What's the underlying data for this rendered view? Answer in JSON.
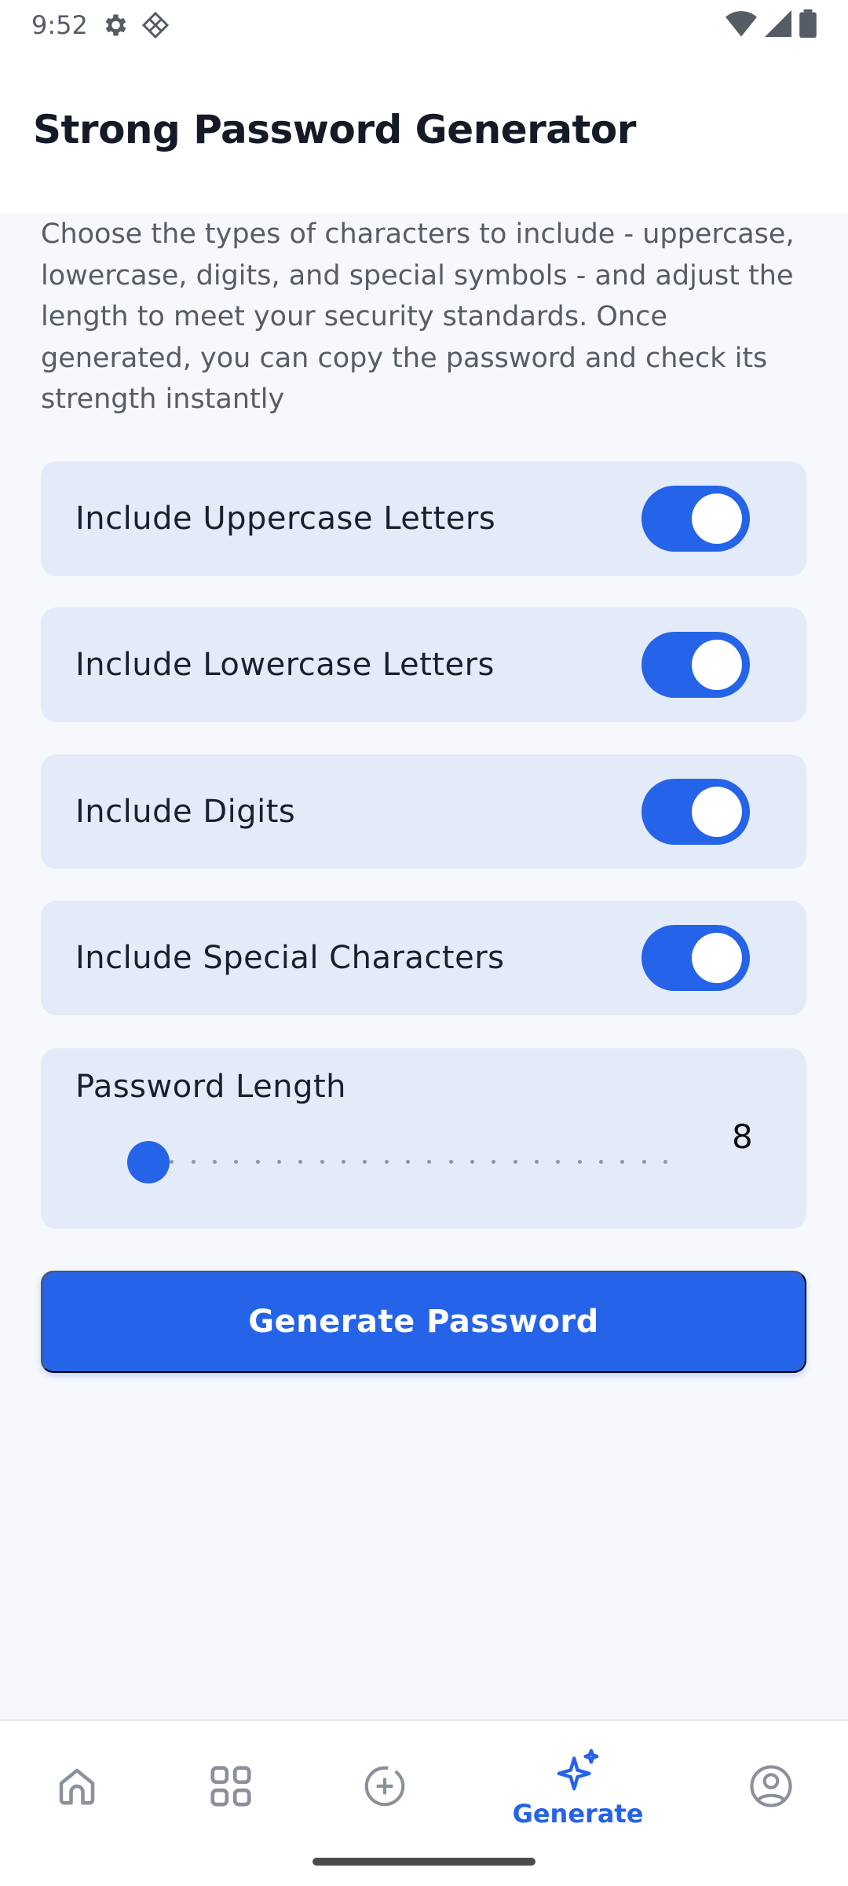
{
  "status_bar": {
    "time": "9:52",
    "left_icons": [
      "gear-icon",
      "diamond-grid-icon"
    ],
    "right_icons": [
      "wifi-icon",
      "cellular-signal-icon",
      "battery-icon"
    ]
  },
  "header": {
    "title": "Strong Password Generator"
  },
  "description": "Choose the types of characters to include - uppercase, lowercase, digits, and special symbols - and adjust the length to meet your security standards. Once generated, you can copy the password and check its strength instantly",
  "options": [
    {
      "label": "Include Uppercase Letters",
      "enabled": true
    },
    {
      "label": "Include Lowercase Letters",
      "enabled": true
    },
    {
      "label": "Include Digits",
      "enabled": true
    },
    {
      "label": "Include Special Characters",
      "enabled": true
    }
  ],
  "length": {
    "label": "Password Length",
    "value": "8",
    "min": 8,
    "max": 32
  },
  "generate_button": {
    "label": "Generate Password"
  },
  "bottom_nav": {
    "items": [
      {
        "icon": "home-icon",
        "label": ""
      },
      {
        "icon": "grid-icon",
        "label": ""
      },
      {
        "icon": "add-circle-icon",
        "label": ""
      },
      {
        "icon": "sparkle-icon",
        "label": "Generate",
        "active": true
      },
      {
        "icon": "profile-icon",
        "label": ""
      }
    ]
  },
  "colors": {
    "accent": "#2563e8",
    "card_background": "#e3eaf8",
    "page_background": "#f6f8fc"
  }
}
